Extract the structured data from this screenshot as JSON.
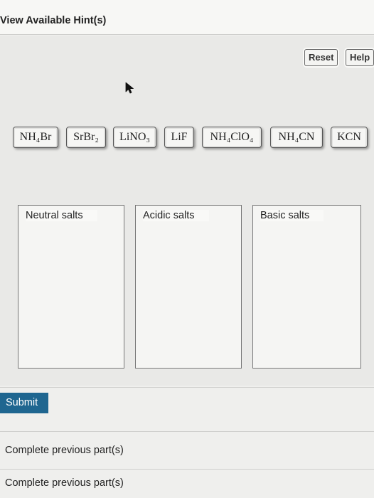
{
  "hints_link": "View Available Hint(s)",
  "toolbar": {
    "reset_label": "Reset",
    "help_label": "Help"
  },
  "tiles": [
    {
      "label": "NH₄Br"
    },
    {
      "label": "SrBr₂"
    },
    {
      "label": "LiNO₃"
    },
    {
      "label": "LiF"
    },
    {
      "label": "NH₄ClO₄"
    },
    {
      "label": "NH₄CN"
    },
    {
      "label": "KCN"
    }
  ],
  "bins": [
    {
      "label": "Neutral salts"
    },
    {
      "label": "Acidic salts"
    },
    {
      "label": "Basic salts"
    }
  ],
  "submit_label": "Submit",
  "next_parts": [
    {
      "label": "Complete previous part(s)"
    },
    {
      "label": "Complete previous part(s)"
    }
  ],
  "colors": {
    "submit_bg": "#1f6690",
    "panel_bg": "#e9e9e7"
  },
  "icons": {
    "cursor": "mouse-pointer-icon"
  }
}
